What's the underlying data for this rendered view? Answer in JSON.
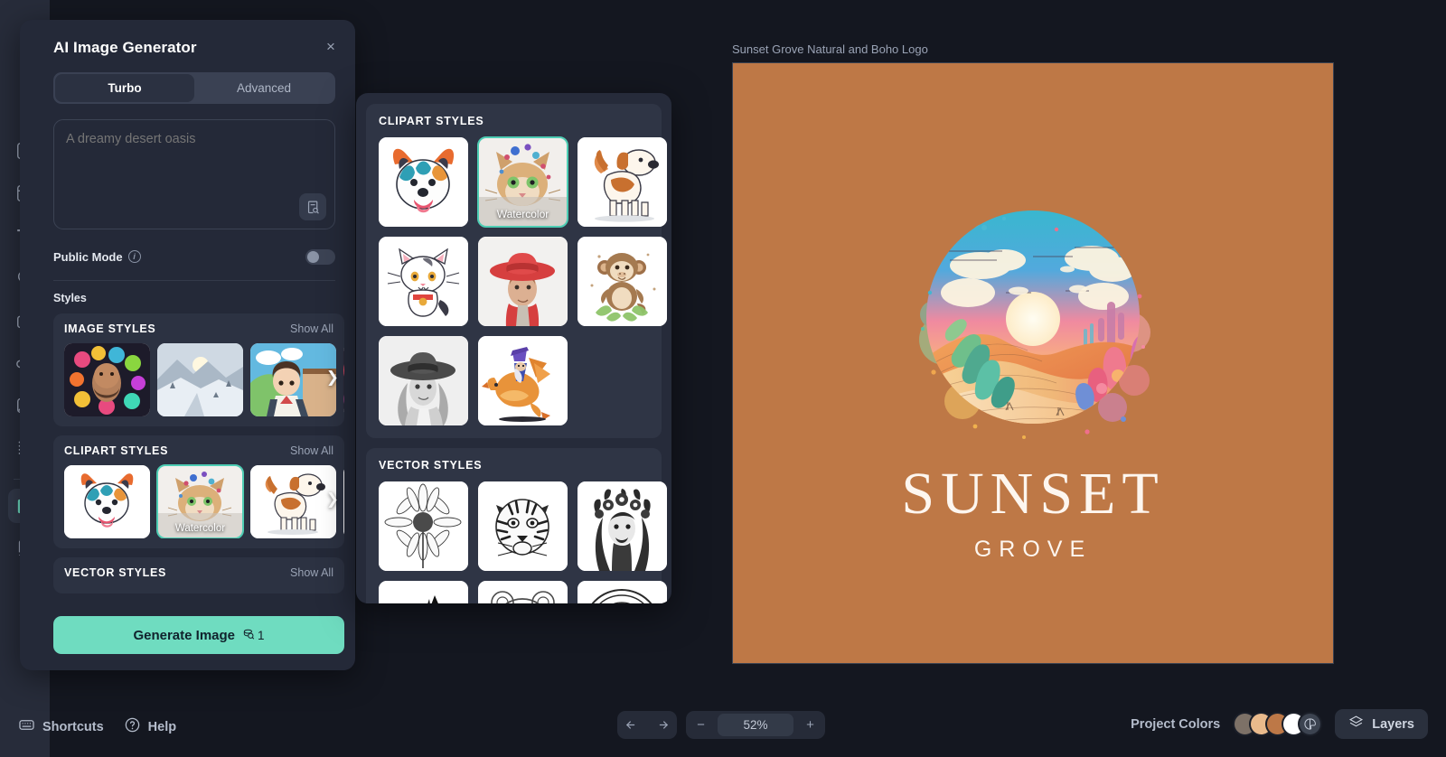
{
  "rail": {
    "items": [
      {
        "name": "design-edit",
        "icon": "pencil-square-icon",
        "active": false
      },
      {
        "name": "templates",
        "icon": "layout-icon",
        "active": false
      },
      {
        "name": "text",
        "icon": "text-tt-icon",
        "active": false
      },
      {
        "name": "shapes",
        "icon": "shapes-icon",
        "active": false
      },
      {
        "name": "brand-kit",
        "icon": "briefcase-icon",
        "active": false
      },
      {
        "name": "uploads",
        "icon": "cloud-upload-icon",
        "active": false
      },
      {
        "name": "photos",
        "icon": "image-icon",
        "active": false
      },
      {
        "name": "patterns",
        "icon": "dots-grid-icon",
        "active": false
      },
      {
        "name": "ai-image-generator",
        "icon": "image-sparkle-icon",
        "active": true
      },
      {
        "name": "ai-page",
        "icon": "file-sparkle-icon",
        "active": false
      }
    ]
  },
  "panel": {
    "title": "AI Image Generator",
    "close_label": "×",
    "tabs": [
      {
        "label": "Turbo",
        "selected": true
      },
      {
        "label": "Advanced",
        "selected": false
      }
    ],
    "prompt": {
      "value": "",
      "placeholder": "A dreamy desert oasis",
      "inspire_icon": "prompt-library-search-icon"
    },
    "public_mode": {
      "label": "Public Mode",
      "info_glyph": "i",
      "enabled": false
    },
    "styles_label": "Styles",
    "groups": [
      {
        "title": "IMAGE STYLES",
        "show_all": "Show All",
        "thumbs": [
          {
            "name": "floral-portrait",
            "caption": "",
            "selected": false
          },
          {
            "name": "snow-valley",
            "caption": "",
            "selected": false
          },
          {
            "name": "anime-boy",
            "caption": "",
            "selected": false
          },
          {
            "name": "pink-abstract",
            "caption": "",
            "selected": false
          }
        ]
      },
      {
        "title": "CLIPART STYLES",
        "show_all": "Show All",
        "thumbs": [
          {
            "name": "colorful-dog",
            "caption": "",
            "selected": false
          },
          {
            "name": "watercolor-cat",
            "caption": "Watercolor",
            "selected": true
          },
          {
            "name": "cartoon-beagle",
            "caption": "",
            "selected": false
          },
          {
            "name": "next-clipart",
            "caption": "",
            "selected": false
          }
        ]
      },
      {
        "title": "VECTOR STYLES",
        "show_all": "Show All",
        "thumbs": []
      }
    ],
    "generate": {
      "label": "Generate Image",
      "credit_icon": "coin-icon",
      "credits": "1"
    }
  },
  "popup": {
    "sections": [
      {
        "title": "CLIPART STYLES",
        "thumbs": [
          {
            "name": "colorful-dog",
            "caption": "",
            "selected": false
          },
          {
            "name": "watercolor-cat",
            "caption": "Watercolor",
            "selected": true
          },
          {
            "name": "cartoon-beagle",
            "caption": "",
            "selected": false
          },
          {
            "name": "kawaii-white-cat",
            "caption": "",
            "selected": false
          },
          {
            "name": "red-hat-man",
            "caption": "",
            "selected": false
          },
          {
            "name": "watercolor-monkey",
            "caption": "",
            "selected": false
          },
          {
            "name": "sketch-woman-hat",
            "caption": "",
            "selected": false
          },
          {
            "name": "pixel-dragon-wizard",
            "caption": "",
            "selected": false
          }
        ]
      },
      {
        "title": "VECTOR STYLES",
        "thumbs": [
          {
            "name": "line-daisy",
            "caption": "",
            "selected": false
          },
          {
            "name": "ink-tiger",
            "caption": "",
            "selected": false
          },
          {
            "name": "floral-crown-man",
            "caption": "",
            "selected": false
          },
          {
            "name": "wolf-silhouette",
            "caption": "",
            "selected": false
          },
          {
            "name": "outline-bear",
            "caption": "",
            "selected": false
          },
          {
            "name": "halo-woman",
            "caption": "",
            "selected": false
          }
        ]
      }
    ]
  },
  "canvas": {
    "title": "Sunset Grove Natural and Boho Logo",
    "background_color": "#be7846",
    "logo": {
      "brand_main": "SUNSET",
      "brand_sub": "GROVE",
      "text_color": "#fdf6ef",
      "art_name": "watercolor-desert-oasis-circle"
    }
  },
  "bottom": {
    "shortcuts": {
      "label": "Shortcuts",
      "icon": "keyboard-icon"
    },
    "help": {
      "label": "Help",
      "icon": "question-circle-icon"
    },
    "history": {
      "undo_icon": "undo-arrow-icon",
      "redo_icon": "redo-arrow-icon"
    },
    "zoom": {
      "minus": "−",
      "value": "52%",
      "plus": "+"
    },
    "project_colors": {
      "label": "Project Colors",
      "swatches": [
        "#7d7167",
        "#e9ba8c",
        "#bd7847",
        "#ffffff"
      ],
      "palette_icon": "palette-icon"
    },
    "layers": {
      "label": "Layers",
      "icon": "layers-icon"
    }
  }
}
